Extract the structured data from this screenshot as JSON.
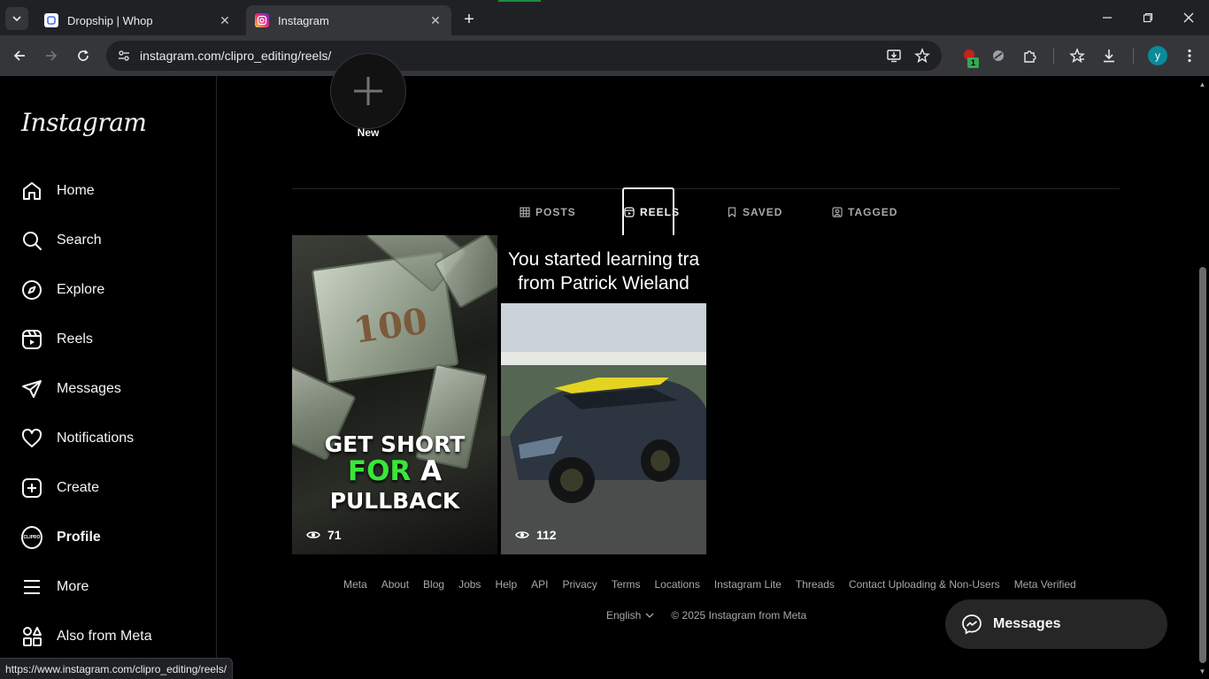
{
  "browser": {
    "tabs": [
      {
        "title": "Dropship | Whop",
        "favicon": "whop-icon"
      },
      {
        "title": "Instagram",
        "favicon": "instagram-icon"
      }
    ],
    "url": "instagram.com/clipro_editing/reels/",
    "status_url": "https://www.instagram.com/clipro_editing/reels/",
    "extension_badge": "1",
    "profile_initial": "y"
  },
  "sidebar": {
    "logo": "Instagram",
    "items": [
      {
        "label": "Home",
        "icon": "home-icon"
      },
      {
        "label": "Search",
        "icon": "search-icon"
      },
      {
        "label": "Explore",
        "icon": "compass-icon"
      },
      {
        "label": "Reels",
        "icon": "reels-icon"
      },
      {
        "label": "Messages",
        "icon": "paper-plane-icon"
      },
      {
        "label": "Notifications",
        "icon": "heart-icon"
      },
      {
        "label": "Create",
        "icon": "plus-square-icon"
      },
      {
        "label": "Profile",
        "icon": "profile-avatar"
      },
      {
        "label": "More",
        "icon": "menu-icon"
      },
      {
        "label": "Also from Meta",
        "icon": "meta-apps-icon"
      }
    ],
    "profile_avatar_text": "CLIPRO"
  },
  "profile": {
    "new_story_label": "New",
    "tabs": [
      {
        "label": "POSTS",
        "icon": "grid-icon"
      },
      {
        "label": "REELS",
        "icon": "reels-icon"
      },
      {
        "label": "SAVED",
        "icon": "bookmark-icon"
      },
      {
        "label": "TAGGED",
        "icon": "tagged-icon"
      }
    ],
    "active_tab": "REELS"
  },
  "reels": [
    {
      "overlay_line1": "GET SHORT",
      "overlay_line2_green": "FOR",
      "overlay_line2_rest": " A",
      "overlay_line3": "PULLBACK",
      "bill_number": "100",
      "views": "71"
    },
    {
      "caption_line1": "You started learning tra",
      "caption_line2": "from Patrick Wieland",
      "views": "112"
    }
  ],
  "footer": {
    "links": [
      "Meta",
      "About",
      "Blog",
      "Jobs",
      "Help",
      "API",
      "Privacy",
      "Terms",
      "Locations",
      "Instagram Lite",
      "Threads",
      "Contact Uploading & Non-Users",
      "Meta Verified"
    ],
    "language": "English",
    "copyright": "© 2025 Instagram from Meta"
  },
  "messages_pill": {
    "label": "Messages"
  },
  "colors": {
    "background": "#000000",
    "text": "#f5f5f5",
    "muted": "#a8a8a8",
    "accent_green": "#39e639"
  }
}
